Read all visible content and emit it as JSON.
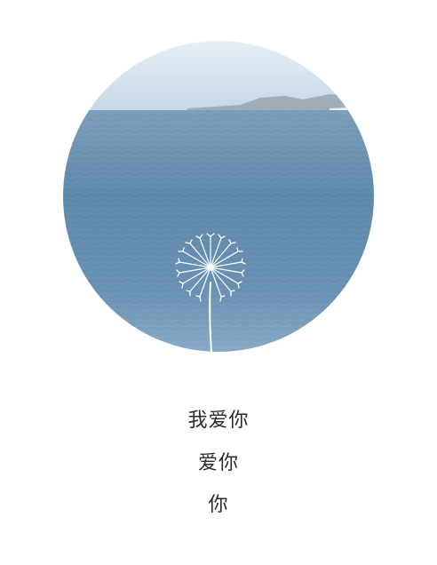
{
  "image": {
    "subject": "circular-sea-photo-with-dandelion",
    "colors": {
      "sky_top": "#e3ecf4",
      "sky_bottom": "#c9dbe8",
      "sea_top": "#6f95b4",
      "sea_mid": "#5c86a8",
      "sea_bottom": "#7aa4c2",
      "land": "#9aaab5",
      "dandelion": "#ffffff"
    }
  },
  "poem": {
    "lines": [
      "我爱你",
      "爱你",
      "你"
    ]
  }
}
